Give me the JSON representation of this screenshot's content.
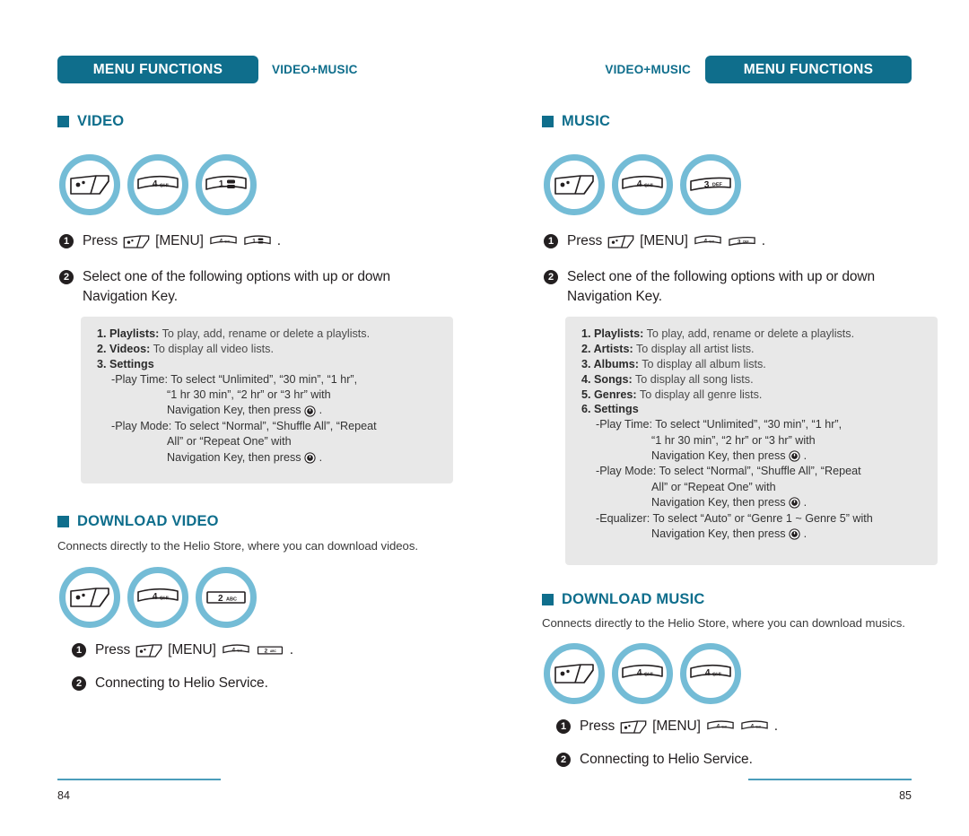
{
  "pages": {
    "left": {
      "banner_label": "MENU FUNCTIONS",
      "chapter_label": "VIDEO+MUSIC",
      "page_number": "84",
      "sections": [
        {
          "title": "VIDEO",
          "steps": {
            "step1_prefix": "Press",
            "step1_menu": "[MENU]",
            "step1_suffix": ".",
            "step2_text": "Select one of the following options with up or down Navigation Key."
          },
          "keys": [
            "menu-key",
            "4-ghi-key",
            "1-key"
          ],
          "options": [
            {
              "num": "1.",
              "name": "Playlists:",
              "desc": "To play, add, rename or delete a playlists."
            },
            {
              "num": "2.",
              "name": "Videos:",
              "desc": "To display all video lists."
            },
            {
              "num": "3.",
              "name": "Settings",
              "desc": ""
            }
          ],
          "settings_lines": [
            "-Play Time: To select “Unlimited”, “30 min”, “1 hr”,",
            "“1 hr 30 min”, “2 hr” or “3 hr” with",
            "Navigation Key, then press",
            "-Play Mode: To select “Normal”, “Shuffle All”, “Repeat",
            "All” or “Repeat One” with",
            "Navigation Key, then press"
          ]
        },
        {
          "title": "DOWNLOAD VIDEO",
          "subtitle": "Connects directly to the Helio Store, where you can download videos.",
          "keys": [
            "menu-key",
            "4-ghi-key",
            "2-abc-key"
          ],
          "steps": {
            "step1_prefix": "Press",
            "step1_menu": "[MENU]",
            "step1_suffix": ".",
            "step2_text": "Connecting to Helio Service."
          }
        }
      ]
    },
    "right": {
      "banner_label": "MENU FUNCTIONS",
      "chapter_label": "VIDEO+MUSIC",
      "page_number": "85",
      "sections": [
        {
          "title": "MUSIC",
          "steps": {
            "step1_prefix": "Press",
            "step1_menu": "[MENU]",
            "step1_suffix": ".",
            "step2_text": "Select one of the following options with up or down Navigation Key."
          },
          "keys": [
            "menu-key",
            "4-ghi-key",
            "3-def-key"
          ],
          "options": [
            {
              "num": "1.",
              "name": "Playlists:",
              "desc": "To play, add, rename or delete a playlists."
            },
            {
              "num": "2.",
              "name": "Artists:",
              "desc": "To display all artist lists."
            },
            {
              "num": "3.",
              "name": "Albums:",
              "desc": "To display all album lists."
            },
            {
              "num": "4.",
              "name": "Songs:",
              "desc": "To display all song lists."
            },
            {
              "num": "5.",
              "name": "Genres:",
              "desc": "To display all genre lists."
            },
            {
              "num": "6.",
              "name": "Settings",
              "desc": ""
            }
          ],
          "settings_lines": [
            "-Play Time: To select “Unlimited”, “30 min”, “1 hr”,",
            "“1 hr 30 min”, “2 hr” or “3 hr” with",
            "Navigation Key, then press",
            "-Play Mode: To select “Normal”, “Shuffle All”, “Repeat",
            "All” or “Repeat One” with",
            "Navigation Key, then press",
            "-Equalizer: To select “Auto” or “Genre 1 ~ Genre 5” with",
            "Navigation Key, then press"
          ]
        },
        {
          "title": "DOWNLOAD MUSIC",
          "subtitle": "Connects directly to the Helio Store, where you can download musics.",
          "keys": [
            "menu-key",
            "4-ghi-key",
            "4-ghi-key"
          ],
          "steps": {
            "step1_prefix": "Press",
            "step1_menu": "[MENU]",
            "step1_suffix": ".",
            "step2_text": "Connecting to Helio Service."
          }
        }
      ]
    }
  },
  "keys": {
    "k1": {
      "digit": "1",
      "letters": ""
    },
    "k2": {
      "digit": "2",
      "letters": "ABC"
    },
    "k3": {
      "digit": "3",
      "letters": "DEF"
    },
    "k4": {
      "digit": "4",
      "letters": "GHI"
    }
  },
  "bullets": {
    "one": "1",
    "two": "2"
  },
  "colors": {
    "brand": "#0f6e8c",
    "key_circle": "#74bcd6",
    "option_box": "#e8e8e8",
    "footer_rule": "#4b9dbb"
  }
}
